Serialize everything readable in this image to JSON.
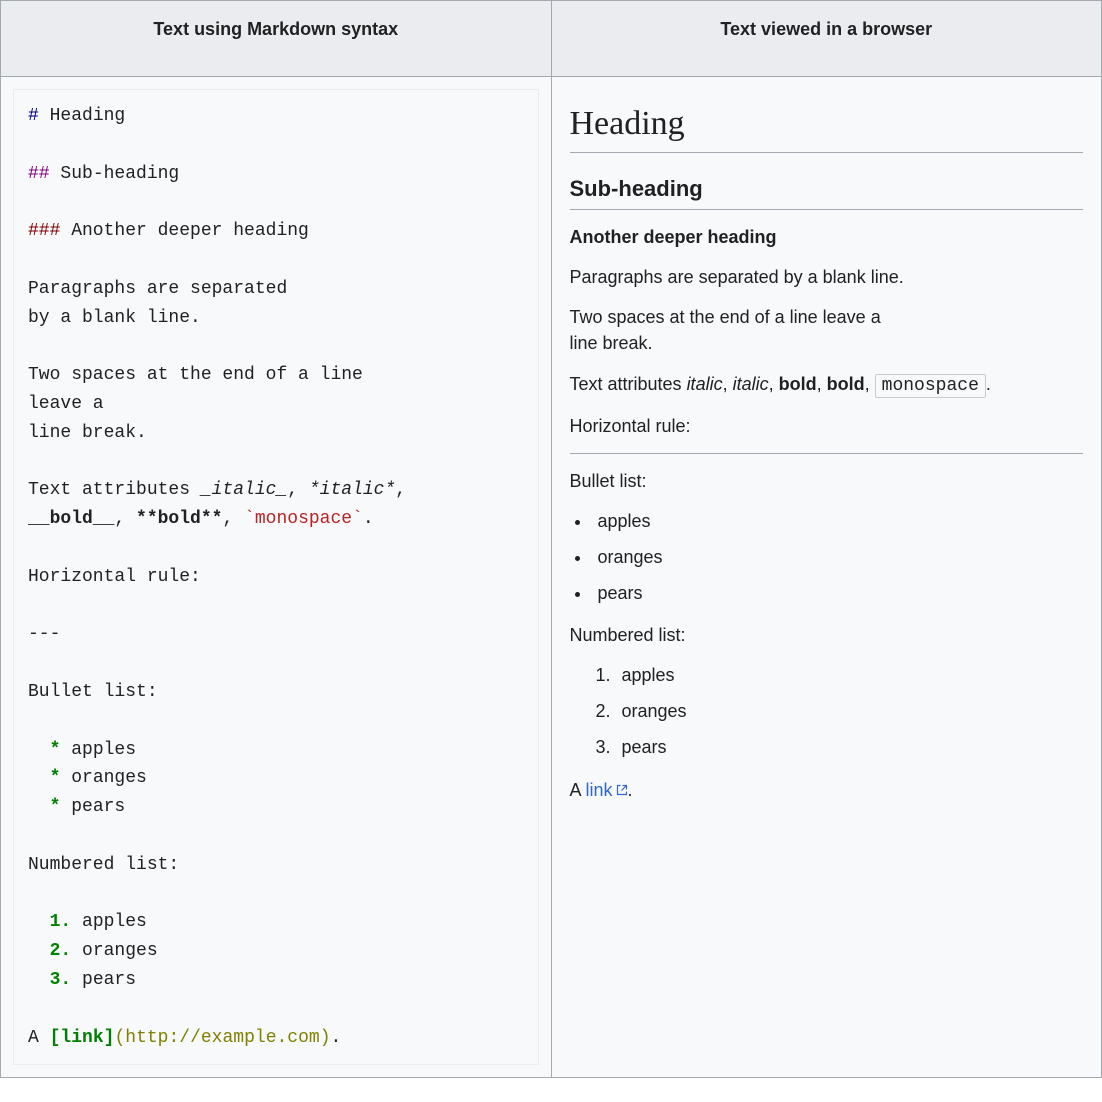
{
  "headers": {
    "left": "Text using Markdown syntax",
    "right": "Text viewed in a browser"
  },
  "markdown": {
    "h1_marker": "#",
    "h1_text": " Heading",
    "h2_marker": "##",
    "h2_text": " Sub-heading",
    "h3_marker": "###",
    "h3_text": " Another deeper heading",
    "para1_line1": "Paragraphs are separated",
    "para1_line2": "by a blank line.",
    "para2_line1": "Two spaces at the end of a line",
    "para2_line2": "leave a",
    "para2_line3": "line break.",
    "attr_prefix": "Text attributes ",
    "italic1": "_italic_",
    "sep1": ", ",
    "italic2": "*italic*",
    "sep2": ",",
    "bold1": "__bold__",
    "sep3": ", ",
    "bold2": "**bold**",
    "sep4": ", ",
    "mono": "`monospace`",
    "period": ".",
    "hr_label": "Horizontal rule:",
    "hr_dashes": "---",
    "bullet_label": "Bullet list:",
    "bullet_star": "  * ",
    "bullet_item1": "apples",
    "bullet_item2": "oranges",
    "bullet_item3": "pears",
    "numbered_label": "Numbered list:",
    "num1": "  1.",
    "num2": "  2.",
    "num3": "  3.",
    "num_item1": " apples",
    "num_item2": " oranges",
    "num_item3": " pears",
    "link_prefix": "A ",
    "link_open": "[",
    "link_text": "link",
    "link_close": "]",
    "link_url_open": "(",
    "link_url": "http://example.com",
    "link_url_close": ")",
    "link_period": "."
  },
  "rendered": {
    "h1": "Heading",
    "h2": "Sub-heading",
    "h3": "Another deeper heading",
    "para1": "Paragraphs are separated by a blank line.",
    "para2_line1": "Two spaces at the end of a line leave a",
    "para2_line2": "line break.",
    "attr_prefix": "Text attributes ",
    "italic1": "italic",
    "sep": ", ",
    "italic2": "italic",
    "bold1": "bold",
    "bold2": "bold",
    "mono": "monospace",
    "period": ".",
    "hr_label": "Horizontal rule:",
    "bullet_label": "Bullet list:",
    "bullet_items": [
      "apples",
      "oranges",
      "pears"
    ],
    "numbered_label": "Numbered list:",
    "numbered_items": [
      "apples",
      "oranges",
      "pears"
    ],
    "link_prefix": "A ",
    "link_text": "link",
    "link_period": "."
  }
}
